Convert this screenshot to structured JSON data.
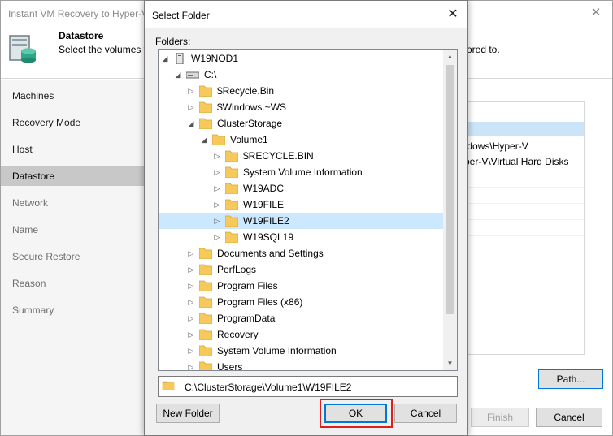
{
  "wizard": {
    "title": "Instant VM Recovery to Hyper-V",
    "header": {
      "title": "Datastore",
      "description": "Select the volumes w",
      "description_tail": "ored to."
    },
    "steps": [
      {
        "label": "Machines",
        "state": "normal"
      },
      {
        "label": "Recovery Mode",
        "state": "normal"
      },
      {
        "label": "Host",
        "state": "normal"
      },
      {
        "label": "Datastore",
        "state": "active"
      },
      {
        "label": "Network",
        "state": "inactive"
      },
      {
        "label": "Name",
        "state": "inactive"
      },
      {
        "label": "Secure Restore",
        "state": "inactive"
      },
      {
        "label": "Reason",
        "state": "inactive"
      },
      {
        "label": "Summary",
        "state": "inactive"
      }
    ],
    "list_rows": [
      "indows\\Hyper-V",
      "yper-V\\Virtual Hard Disks"
    ],
    "path_button": "Path...",
    "finish_button": "Finish",
    "cancel_button": "Cancel"
  },
  "dialog": {
    "title": "Select Folder",
    "close_icon": "close-icon",
    "folders_label": "Folders:",
    "tree": [
      {
        "label": "W19NOD1",
        "level": 0,
        "expander": "expanded",
        "icon": "computer-icon"
      },
      {
        "label": "C:\\",
        "level": 1,
        "expander": "expanded",
        "icon": "drive-icon"
      },
      {
        "label": "$Recycle.Bin",
        "level": 2,
        "expander": "collapsed",
        "icon": "folder-icon"
      },
      {
        "label": "$Windows.~WS",
        "level": 2,
        "expander": "collapsed",
        "icon": "folder-icon"
      },
      {
        "label": "ClusterStorage",
        "level": 2,
        "expander": "expanded",
        "icon": "folder-icon"
      },
      {
        "label": "Volume1",
        "level": 3,
        "expander": "expanded",
        "icon": "folder-icon"
      },
      {
        "label": "$RECYCLE.BIN",
        "level": 4,
        "expander": "collapsed",
        "icon": "folder-icon"
      },
      {
        "label": "System Volume Information",
        "level": 4,
        "expander": "collapsed",
        "icon": "folder-icon"
      },
      {
        "label": "W19ADC",
        "level": 4,
        "expander": "collapsed",
        "icon": "folder-icon"
      },
      {
        "label": "W19FILE",
        "level": 4,
        "expander": "collapsed",
        "icon": "folder-icon"
      },
      {
        "label": "W19FILE2",
        "level": 4,
        "expander": "collapsed",
        "icon": "folder-icon",
        "selected": true
      },
      {
        "label": "W19SQL19",
        "level": 4,
        "expander": "collapsed",
        "icon": "folder-icon"
      },
      {
        "label": "Documents and Settings",
        "level": 2,
        "expander": "collapsed",
        "icon": "folder-icon"
      },
      {
        "label": "PerfLogs",
        "level": 2,
        "expander": "collapsed",
        "icon": "folder-icon"
      },
      {
        "label": "Program Files",
        "level": 2,
        "expander": "collapsed",
        "icon": "folder-icon"
      },
      {
        "label": "Program Files (x86)",
        "level": 2,
        "expander": "collapsed",
        "icon": "folder-icon"
      },
      {
        "label": "ProgramData",
        "level": 2,
        "expander": "collapsed",
        "icon": "folder-icon"
      },
      {
        "label": "Recovery",
        "level": 2,
        "expander": "collapsed",
        "icon": "folder-icon"
      },
      {
        "label": "System Volume Information",
        "level": 2,
        "expander": "collapsed",
        "icon": "folder-icon"
      },
      {
        "label": "Users",
        "level": 2,
        "expander": "collapsed",
        "icon": "folder-icon"
      }
    ],
    "selected_path": "C:\\ClusterStorage\\Volume1\\W19FILE2",
    "new_folder_button": "New Folder",
    "ok_button": "OK",
    "cancel_button": "Cancel",
    "colors": {
      "selection": "#cce8ff",
      "folder": "#f7c95a",
      "highlight_frame": "#e01e1e",
      "default_button_border": "#0078d7"
    }
  }
}
